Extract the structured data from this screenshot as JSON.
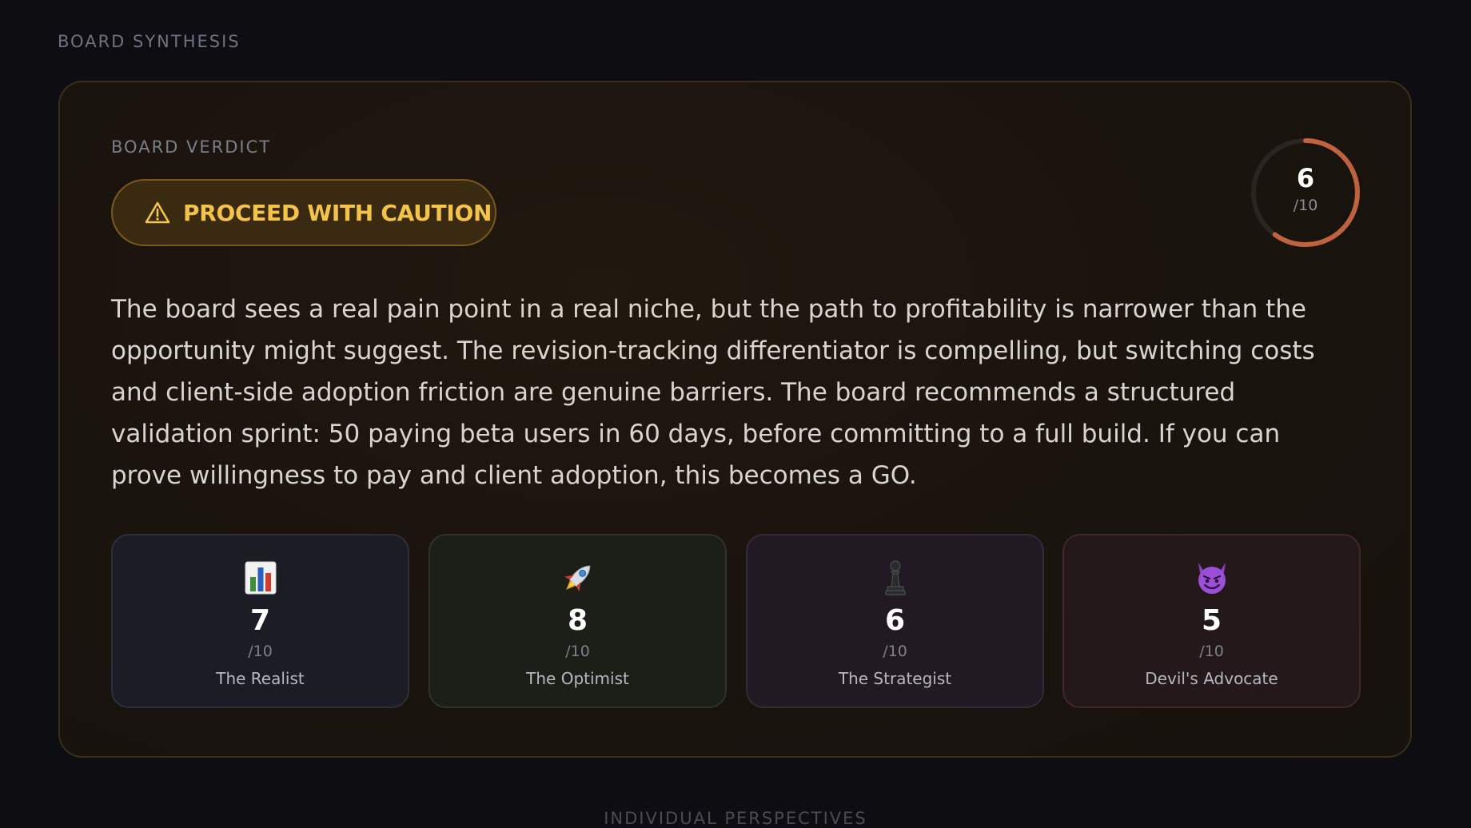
{
  "section": {
    "label": "BOARD SYNTHESIS"
  },
  "verdict": {
    "label": "BOARD VERDICT",
    "text": "PROCEED WITH CAUTION",
    "icon": "warning-triangle-icon",
    "color": "#f3c34a",
    "score": "6",
    "score_max": "/10",
    "score_fraction": 0.6,
    "ring_color": "#c0613f"
  },
  "summary": "The board sees a real pain point in a real niche, but the path to profitability is narrower than the opportunity might suggest. The revision-tracking differentiator is compelling, but switching costs and client-side adoption friction are genuine barriers. The board recommends a structured validation sprint: 50 paying beta users in 60 days, before committing to a full build. If you can prove willingness to pay and client adoption, this becomes a GO.",
  "advisors": [
    {
      "emoji": "📊",
      "icon": "bar-chart-icon",
      "score": "7",
      "max": "/10",
      "name": "The Realist"
    },
    {
      "emoji": "🚀",
      "icon": "rocket-icon",
      "score": "8",
      "max": "/10",
      "name": "The Optimist"
    },
    {
      "emoji": "♟️",
      "icon": "chess-pawn-icon",
      "score": "6",
      "max": "/10",
      "name": "The Strategist"
    },
    {
      "emoji": "😈",
      "icon": "devil-face-icon",
      "score": "5",
      "max": "/10",
      "name": "Devil's Advocate"
    }
  ],
  "next_section": {
    "label": "INDIVIDUAL PERSPECTIVES"
  }
}
